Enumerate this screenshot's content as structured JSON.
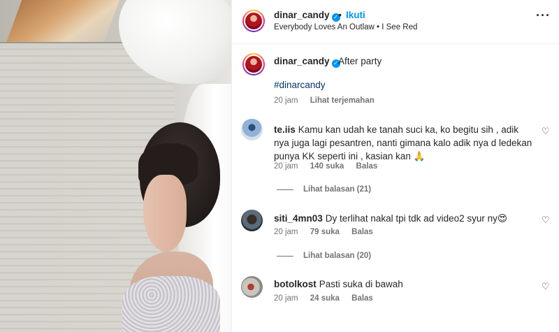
{
  "post": {
    "username": "dinar_candy",
    "follow_label": "Ikuti",
    "dot": "•",
    "audio": "Everybody Loves An Outlaw • I See Red",
    "more_label": "···"
  },
  "caption": {
    "username": "dinar_candy",
    "text": "After party",
    "hashtag": "#dinarcandy",
    "time": "20 jam",
    "translate_label": "Lihat terjemahan"
  },
  "comments": [
    {
      "username": "te.iis",
      "text": "Kamu kan udah ke tanah suci ka, ko begitu sih , adik nya juga lagi pesantren, nanti gimana kalo adik nya d ledekan punya KK seperti ini , kasian kan 🙏",
      "time": "20 jam",
      "likes": "140 suka",
      "reply_label": "Balas",
      "view_replies": "Lihat balasan (21)"
    },
    {
      "username": "siti_4mn03",
      "text": "Dy terlihat nakal tpi tdk ad video2 syur ny😍",
      "time": "20 jam",
      "likes": "79 suka",
      "reply_label": "Balas",
      "view_replies": "Lihat balasan (20)"
    },
    {
      "username": "botolkost",
      "text": "Pasti suka di bawah",
      "time": "20 jam",
      "likes": "24 suka",
      "reply_label": "Balas"
    }
  ],
  "icons": {
    "verified": "verified-badge-icon",
    "heart": "heart-icon"
  },
  "colors": {
    "link_blue": "#0095f6",
    "hashtag": "#00376b",
    "muted": "#737373"
  }
}
